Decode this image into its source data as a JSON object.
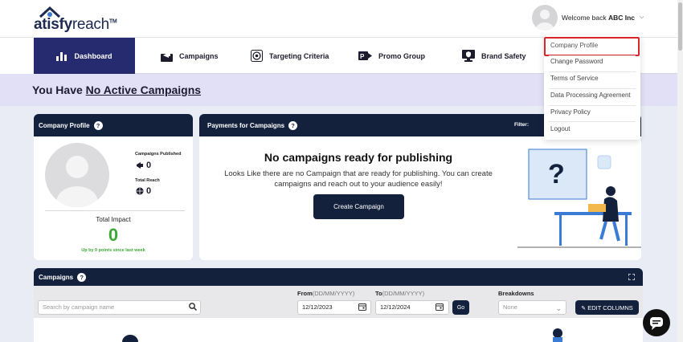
{
  "brand": {
    "logo_main": "atisfy",
    "logo_accent": "reach",
    "logo_tm": "TM"
  },
  "user": {
    "welcome_prefix": "Welcome back",
    "company": "ABC Inc"
  },
  "nav": {
    "items": [
      {
        "label": "Dashboard",
        "icon": "bar-chart-icon",
        "active": true
      },
      {
        "label": "Campaigns",
        "icon": "megaphone-icon"
      },
      {
        "label": "Targeting Criteria",
        "icon": "target-icon"
      },
      {
        "label": "Promo Group",
        "icon": "promo-tag-icon"
      },
      {
        "label": "Brand Safety",
        "icon": "shield-monitor-icon"
      }
    ]
  },
  "banner": {
    "prefix": "You Have",
    "link": "No Active Campaigns"
  },
  "company_profile": {
    "title": "Company Profile",
    "campaigns_published_label": "Campaigns Published",
    "campaigns_published_value": "0",
    "total_reach_label": "Total Reach",
    "total_reach_value": "0",
    "total_impact_label": "Total Impact",
    "total_impact_value": "0",
    "impact_sub": "Up by 0 points since last week"
  },
  "payments": {
    "title": "Payments for Campaigns",
    "filter_label": "Filter:",
    "heading": "No campaigns ready for publishing",
    "description": "Looks Like there are no Campaign that are ready for publishing. You can create campaigns and reach out to your audience easily!",
    "create_button": "Create Campaign"
  },
  "dropdown": {
    "items": [
      "Company Profile",
      "Change Password",
      "Terms of Service",
      "Data Processing Agreement",
      "Privacy Policy",
      "Logout"
    ],
    "highlighted": "Company Profile"
  },
  "campaigns": {
    "title": "Campaigns",
    "search_placeholder": "Search by campaign name",
    "from_label": "From",
    "to_label": "To",
    "date_format": "(DD/MM/YYYY)",
    "from_value": "12/12/2023",
    "to_value": "12/12/2024",
    "go_button": "Go",
    "breakdowns_label": "Breakdowns",
    "breakdowns_value": "None",
    "edit_columns_button": "EDIT COLUMNS"
  },
  "colors": {
    "navy": "#14213d",
    "indigo": "#262a6e",
    "green": "#3aaa35",
    "highlight_red": "#d9262c",
    "banner_bg": "#e2e0f6"
  }
}
